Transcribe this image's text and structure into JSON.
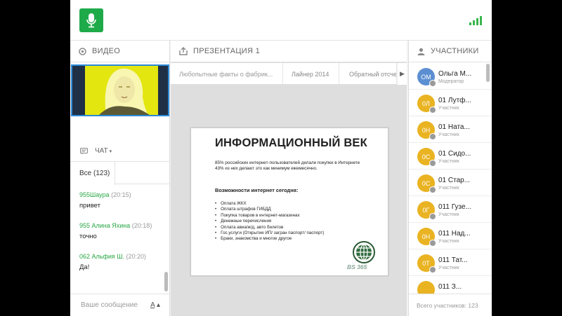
{
  "colors": {
    "accent": "#1faa4a",
    "chat_author": "#28a745",
    "moderator_avatar": "#5c8fd1",
    "participant_avatar": "#e9b322",
    "video_border": "#2a89d8"
  },
  "header": {
    "logo_icon": "microphone-icon",
    "signal_icon": "signal-strength-icon"
  },
  "video_panel": {
    "title": "ВИДЕО"
  },
  "presentation_panel": {
    "title": "ПРЕЗЕНТАЦИЯ 1",
    "tabs": [
      "Любопытные факты о фабрик...",
      "Лайнер 2014",
      "Обратный отсчет"
    ],
    "slide": {
      "title": "ИНФОРМАЦИОННЫЙ ВЕК",
      "intro_1": "85% российских интернет-пользователей делали покупки в Интернете",
      "intro_2": "43% из них делают это как минимум ежемесячно.",
      "subtitle": "Возможности интернет сегодня:",
      "items": [
        "Оплата ЖКХ",
        "Оплата штрафов ГИБДД",
        "Покупка товаров в интернет-магазинах",
        "Денежные перечисления",
        "Оплата авиа/ж/д, авто билетов",
        "Гос.услуги (Открытие ИП/ загран паспорт/ паспорт)",
        "Браки, знакомства и многое другое"
      ],
      "logo_text": "BS 365"
    }
  },
  "chat_panel": {
    "title": "ЧАТ",
    "tab_all": "Все (123)",
    "messages": [
      {
        "author": "955Шаура",
        "time": "(20:15)",
        "text": "привет"
      },
      {
        "author": "955 Алина Яхина",
        "time": "(20:18)",
        "text": "точно"
      },
      {
        "author": "062 Альфия Ш.",
        "time": "(20:20)",
        "text": "Да!"
      }
    ],
    "input_placeholder": "Ваше сообщение",
    "format_label": "A"
  },
  "participants_panel": {
    "title": "УЧАСТНИКИ",
    "participants": [
      {
        "initials": "ОМ",
        "name": "Ольга М...",
        "role": "Модератор"
      },
      {
        "initials": "0Л",
        "name": "01 Лутф...",
        "role": "Участник"
      },
      {
        "initials": "0Н",
        "name": "01 Ната...",
        "role": "Участник"
      },
      {
        "initials": "0С",
        "name": "01 Сидо...",
        "role": "Участник"
      },
      {
        "initials": "0С",
        "name": "01 Стар...",
        "role": "Участник"
      },
      {
        "initials": "0Г",
        "name": "011 Гузе...",
        "role": "Участник"
      },
      {
        "initials": "0Н",
        "name": "011 Над...",
        "role": "Участник"
      },
      {
        "initials": "0Т",
        "name": "011 Тат...",
        "role": "Участник"
      },
      {
        "initials": "",
        "name": "011 З...",
        "role": ""
      }
    ],
    "total_label": "Всего участников: 123"
  }
}
